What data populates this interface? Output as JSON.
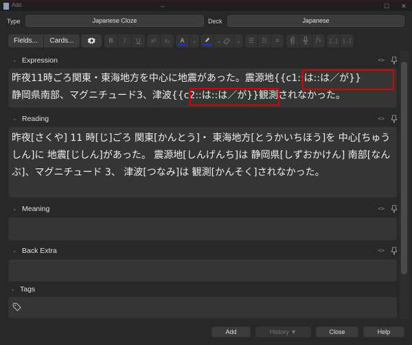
{
  "window": {
    "title": "Add",
    "minimize": "–",
    "maximize": "☐",
    "close": "✕"
  },
  "top": {
    "type_label": "Type",
    "type_value": "Japanese Cloze",
    "deck_label": "Deck",
    "deck_value": "Japanese"
  },
  "toolbar": {
    "fields_label": "Fields...",
    "cards_label": "Cards...",
    "settings_icon": "gear-icon",
    "bold": "B",
    "italic": "I",
    "underline": "U",
    "superscript": "x²",
    "subscript": "x₂",
    "text_color": "A",
    "dropdown": "⌄",
    "highlight_color_hex": "#1a2fe0",
    "text_color_hex": "#1a2fe0",
    "unordered_list": "☰",
    "ordered_list": "☷",
    "align": "≡",
    "attach": "📎",
    "record": "🎙",
    "math": "fx",
    "cloze_new": "[...]",
    "cloze_same": "[...]"
  },
  "fields": [
    {
      "name": "Expression",
      "value_line1_before": "昨夜11時ごろ関東・東海地方を中心に地震があった。震源地",
      "cloze1": "{{c1::は::は／が}}",
      "value_line2_before": "静岡県南部、マグニチュード3、津波",
      "cloze2": "{{c2::は::は／が}}",
      "value_line2_after": "観測されなかった。"
    },
    {
      "name": "Reading",
      "value": "昨夜[さくや] 11 時[じ]ごろ 関東[かんとう]・ 東海地方[とうかいちほう]を 中心[ちゅうしん]に 地震[じしん]があった。 震源地[しんげんち]は 静岡県[しずおかけん] 南部[なんぶ]、マグニチュード 3、 津波[つなみ]は 観測[かんそく]されなかった。"
    },
    {
      "name": "Meaning",
      "value": ""
    },
    {
      "name": "Back Extra",
      "value": ""
    }
  ],
  "field_controls": {
    "html_toggle": "<>",
    "collapse_chevron": "⌄"
  },
  "tags": {
    "label": "Tags",
    "value": ""
  },
  "buttons": {
    "add": "Add",
    "history": "History ▼",
    "close": "Close",
    "help": "Help"
  },
  "highlight": {
    "cloze_outline_color": "#e00000"
  }
}
